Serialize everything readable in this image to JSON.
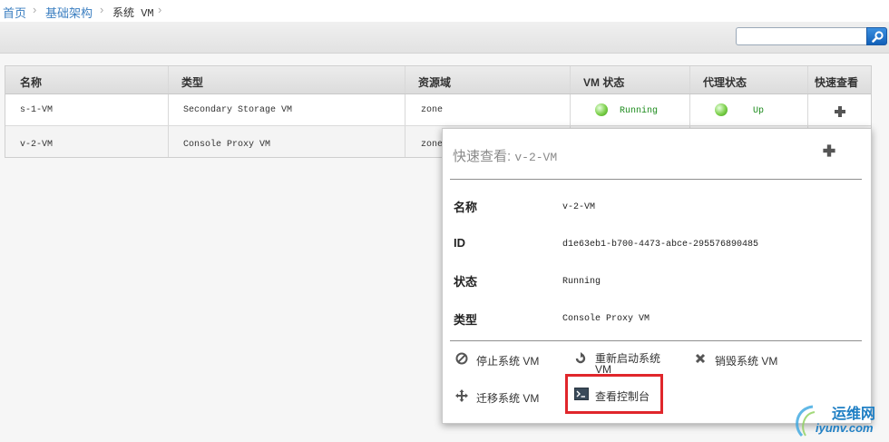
{
  "breadcrumb": {
    "home": "首页",
    "infra": "基础架构",
    "current": "系统 VM"
  },
  "search": {
    "placeholder": "",
    "value": ""
  },
  "table": {
    "headers": [
      "名称",
      "类型",
      "资源域",
      "VM 状态",
      "代理状态",
      "快速查看"
    ],
    "rows": [
      {
        "name": "s-1-VM",
        "type": "Secondary Storage VM",
        "zone": "zone",
        "vm_state": "Running",
        "agent_state": "Up"
      },
      {
        "name": "v-2-VM",
        "type": "Console Proxy VM",
        "zone": "zone"
      }
    ]
  },
  "quickview": {
    "title_prefix": "快速查看:",
    "title_name": "v-2-VM",
    "details": [
      {
        "label": "名称",
        "value": "v-2-VM"
      },
      {
        "label": "ID",
        "value": "d1e63eb1-b700-4473-abce-295576890485"
      },
      {
        "label": "状态",
        "value": "Running"
      },
      {
        "label": "类型",
        "value": "Console Proxy VM"
      }
    ],
    "actions": {
      "stop": "停止系统 VM",
      "reboot": "重新启动系统 VM",
      "destroy": "销毁系统 VM",
      "migrate": "迁移系统 VM",
      "console": "查看控制台"
    }
  },
  "watermark": {
    "cn": "运维网",
    "domain": "iyunv.com"
  },
  "colors": {
    "link": "#3c7fc1",
    "running": "#1a8a1a",
    "highlight": "#e0262b"
  }
}
